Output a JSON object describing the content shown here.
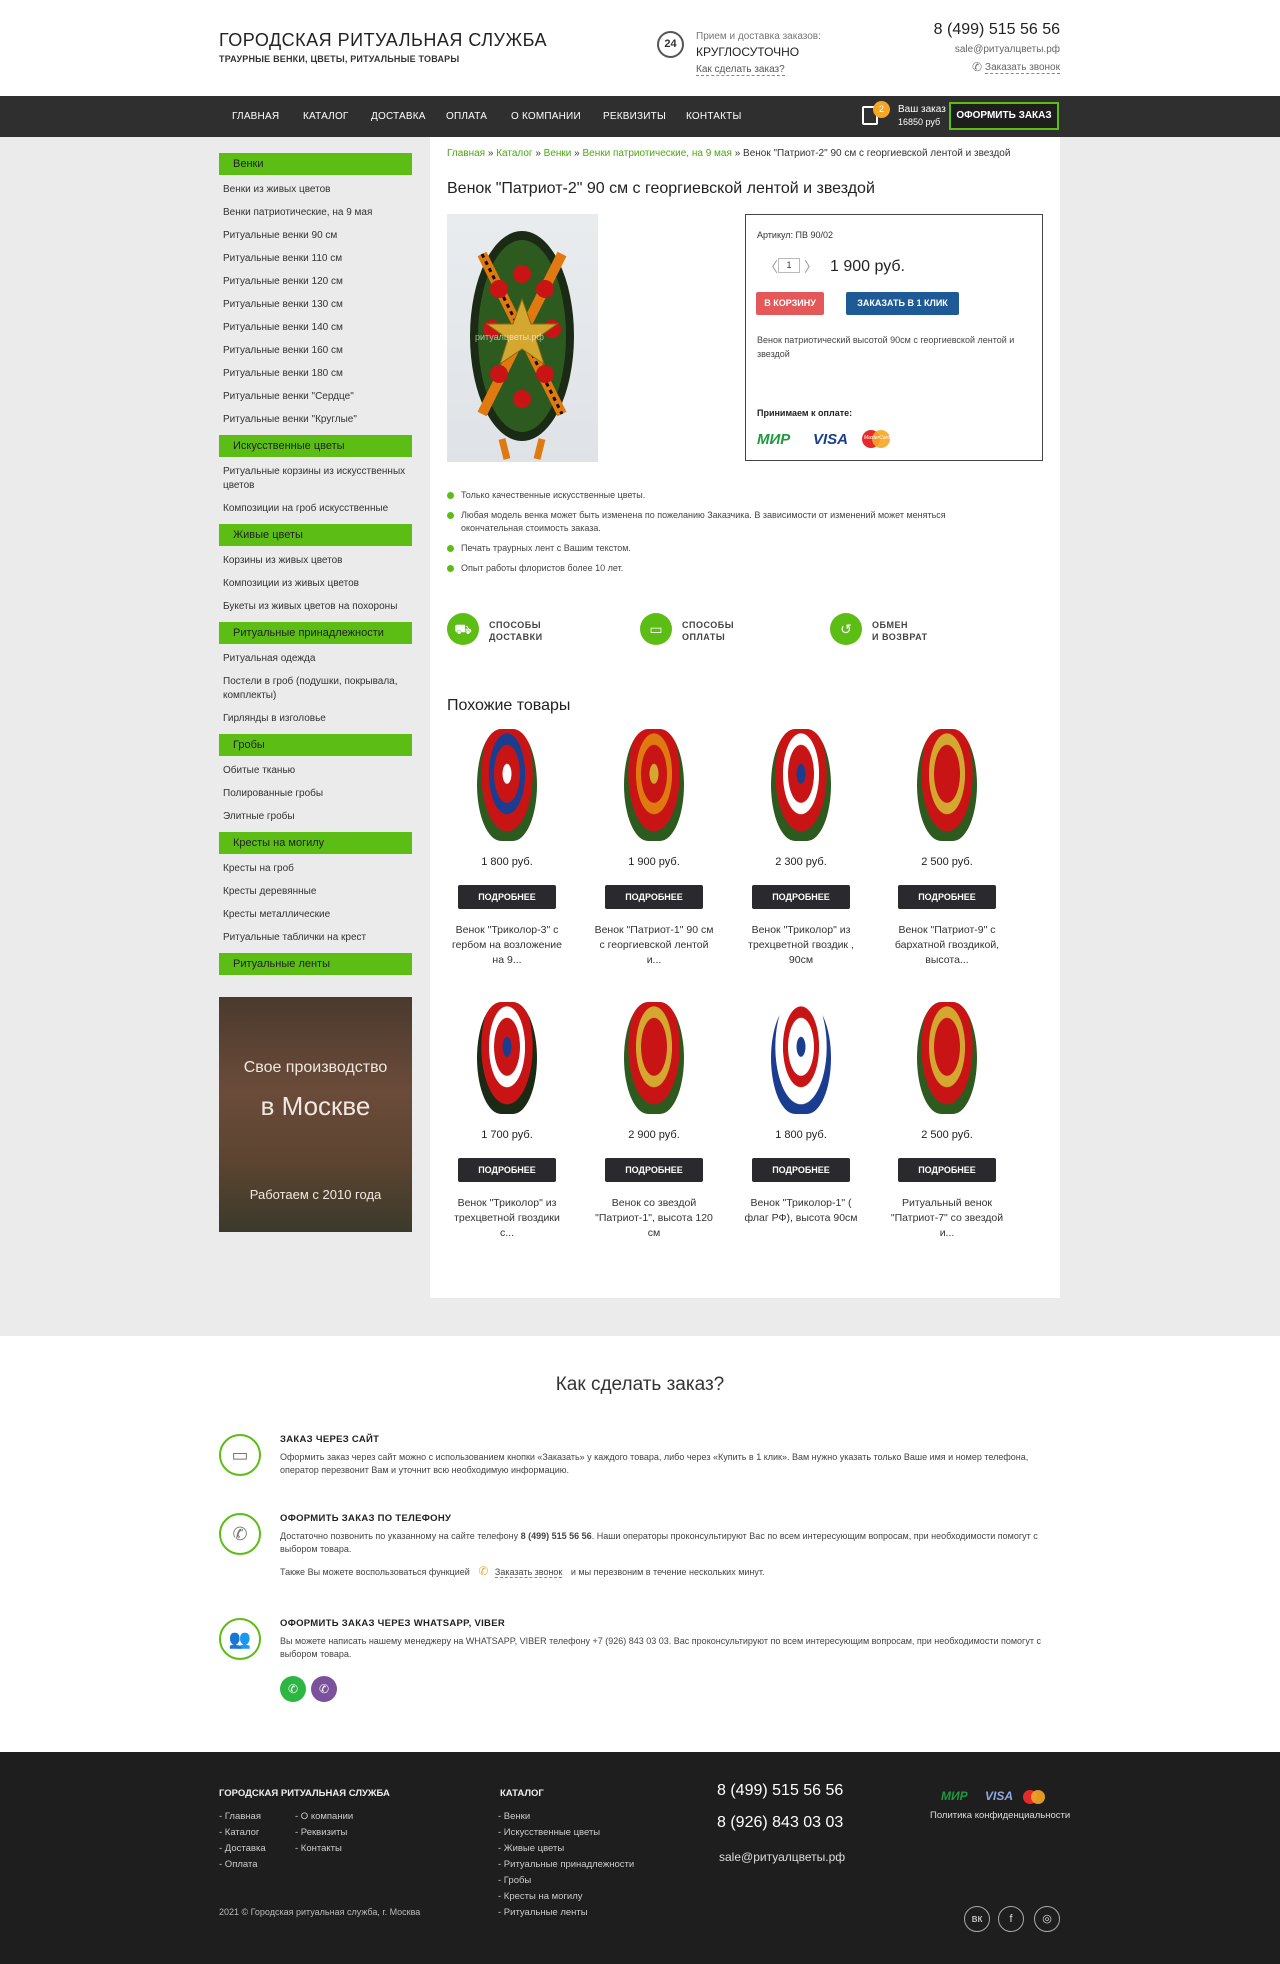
{
  "header": {
    "title": "ГОРОДСКАЯ РИТУАЛЬНАЯ СЛУЖБА",
    "subtitle": "ТРАУРНЫЕ ВЕНКИ, ЦВЕТЫ, РИТУАЛЬНЫЕ ТОВАРЫ",
    "clock_label": "24",
    "receive_label": "Прием и доставка заказов:",
    "round_clock": "КРУГЛОСУТОЧНО",
    "how_link": "Как сделать заказ?",
    "phone": "8 (499) 515 56 56",
    "email": "sale@ритуалцветы.рф",
    "callback": "Заказать звонок"
  },
  "nav": {
    "items": [
      "ГЛАВНАЯ",
      "КАТАЛОГ",
      "ДОСТАВКА",
      "ОПЛАТА",
      "О КОМПАНИИ",
      "РЕКВИЗИТЫ",
      "КОНТАКТЫ"
    ],
    "cart_count": "2",
    "cart_label": "Ваш заказ",
    "cart_sum": "16850 руб",
    "order_button": "ОФОРМИТЬ ЗАКАЗ"
  },
  "sidebar": {
    "groups": [
      {
        "title": "Венки",
        "items": [
          "Венки из живых цветов",
          "Венки патриотические, на 9 мая",
          "Ритуальные венки 90 см",
          "Ритуальные венки 110 см",
          "Ритуальные венки 120 см",
          "Ритуальные венки 130 см",
          "Ритуальные венки 140 см",
          "Ритуальные венки 160 см",
          "Ритуальные венки 180 см",
          "Ритуальные венки \"Сердце\"",
          "Ритуальные венки \"Круглые\""
        ]
      },
      {
        "title": "Искусственные цветы",
        "items": [
          "Ритуальные корзины из искусственных цветов",
          "Композиции на гроб искусственные"
        ]
      },
      {
        "title": "Живые цветы",
        "items": [
          "Корзины из живых цветов",
          "Композиции из живых цветов",
          "Букеты из живых цветов на похороны"
        ]
      },
      {
        "title": "Ритуальные принадлежности",
        "items": [
          "Ритуальная одежда",
          "Постели в гроб (подушки, покрывала, комплекты)",
          "Гирлянды в изголовье"
        ]
      },
      {
        "title": "Гробы",
        "items": [
          "Обитые тканью",
          "Полированные гробы",
          "Элитные гробы"
        ]
      },
      {
        "title": "Кресты на могилу",
        "items": [
          "Кресты на гроб",
          "Кресты деревянные",
          "Кресты металлические",
          "Ритуальные таблички на крест"
        ]
      },
      {
        "title": "Ритуальные ленты",
        "items": []
      }
    ],
    "banner": {
      "line1": "Свое производство",
      "line2": "в Москве",
      "line3": "Работаем с 2010 года"
    }
  },
  "breadcrumb": {
    "b1": "Главная",
    "b2": "Каталог",
    "b3": "Венки",
    "b4": "Венки патриотические, на 9 мая",
    "sep": "»",
    "current": "Венок \"Патриот-2\" 90 см с георгиевской лентой и звездой"
  },
  "product": {
    "title": "Венок \"Патриот-2\" 90 см с георгиевской лентой и звездой",
    "watermark": "ритуалцветы.рф",
    "article": "Артикул: ПВ 90/02",
    "qty": "1",
    "price": "1 900 руб.",
    "cart_button": "В КОРЗИНУ",
    "one_click_button": "ЗАКАЗАТЬ В 1 КЛИК",
    "description": "Венок патриотический высотой 90см с георгиевской лентой и звездой",
    "pay_heading": "Принимаем к оплате:",
    "pay_mir": "МИР",
    "pay_visa": "VISA",
    "pay_mc": "MasterCard"
  },
  "features": [
    "Только качественные искусственные цветы.",
    "Любая модель венка может быть изменена по пожеланию Заказчика. В зависимости от изменений может меняться окончательная стоимость заказа.",
    "Печать траурных лент с Вашим текстом.",
    "Опыт работы флористов более 10 лет."
  ],
  "services": [
    {
      "line1": "СПОСОБЫ",
      "line2": "ДОСТАВКИ"
    },
    {
      "line1": "СПОСОБЫ",
      "line2": "ОПЛАТЫ"
    },
    {
      "line1": "ОБМЕН",
      "line2": "И ВОЗВРАТ"
    }
  ],
  "similar": {
    "heading": "Похожие товары",
    "more_label": "ПОДРОБНЕЕ",
    "items": [
      {
        "price": "1 800 руб.",
        "name": "Венок \"Триколор-3\" с гербом на возложение на 9..."
      },
      {
        "price": "1 900 руб.",
        "name": "Венок \"Патриот-1\" 90 см с георгиевской лентой и..."
      },
      {
        "price": "2 300 руб.",
        "name": "Венок \"Триколор\" из трехцветной гвоздик , 90см"
      },
      {
        "price": "2 500 руб.",
        "name": "Венок \"Патриот-9\" с бархатной гвоздикой, высота..."
      },
      {
        "price": "1 700 руб.",
        "name": "Венок \"Триколор\" из трехцветной гвоздики с..."
      },
      {
        "price": "2 900 руб.",
        "name": "Венок со звездой \"Патриот-1\", высота 120 см"
      },
      {
        "price": "1 800 руб.",
        "name": "Венок \"Триколор-1\" ( флаг РФ), высота 90см"
      },
      {
        "price": "2 500 руб.",
        "name": "Ритуальный венок \"Патриот-7\" со звездой и..."
      }
    ]
  },
  "how": {
    "title": "Как сделать заказ?",
    "site": {
      "heading": "ЗАКАЗ ЧЕРЕЗ САЙТ",
      "text": "Оформить заказ через сайт можно с использованием кнопки «Заказать» у каждого товара, либо через «Купить в 1 клик». Вам нужно указать только Ваше имя и номер телефона, оператор перезвонит Вам и уточнит всю необходимую информацию."
    },
    "phone": {
      "heading": "ОФОРМИТЬ ЗАКАЗ ПО ТЕЛЕФОНУ",
      "text_a": "Достаточно позвонить по указанному на сайте телефону",
      "phone": "8 (499) 515 56 56",
      "text_b": ". Наши операторы проконсультируют Вас по всем интересующим вопросам, при необходимости помогут с выбором товара.",
      "also": "Также Вы можете воспользоваться функцией",
      "callback": "Заказать звонок",
      "also_b": "и мы перезвоним в течение нескольких минут."
    },
    "messenger": {
      "heading": "ОФОРМИТЬ ЗАКАЗ ЧЕРЕЗ WHATSAPP, VIBER",
      "text": "Вы можете написать нашему менеджеру на WHATSAPP, VIBER телефону +7 (926) 843 03 03. Вас проконсультируют по всем интересующим вопросам, при необходимости помогут с выбором товара."
    }
  },
  "footer": {
    "company_heading": "ГОРОДСКАЯ РИТУАЛЬНАЯ СЛУЖБА",
    "col1": [
      "- Главная",
      "- Каталог",
      "- Доставка",
      "- Оплата"
    ],
    "col2": [
      "- О компании",
      "- Реквизиты",
      "- Контакты"
    ],
    "catalog_heading": "КАТАЛОГ",
    "catalog": [
      "- Венки",
      "- Искусственные цветы",
      "- Живые цветы",
      "- Ритуальные принадлежности",
      "- Гробы",
      "- Кресты на могилу",
      "- Ритуальные ленты"
    ],
    "phone1": "8 (499) 515 56 56",
    "phone2": "8 (926) 843 03 03",
    "email": "sale@ритуалцветы.рф",
    "policy": "Политика конфиденциальности",
    "copyright": "2021 © Городская ритуальная служба, г. Москва",
    "social": [
      "вк",
      "f",
      "◎"
    ]
  },
  "colors": {
    "accent": "#5cbd15",
    "nav": "#2f2f2f",
    "footer": "#1e1e1e",
    "cart_btn": "#e5585a",
    "one_click_btn": "#1e5a96"
  }
}
